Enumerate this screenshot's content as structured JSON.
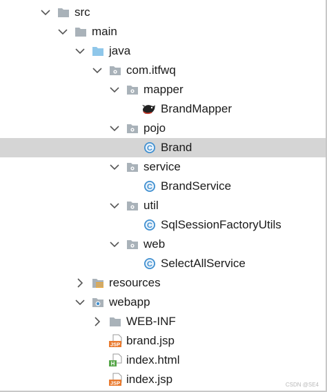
{
  "tree": {
    "items": [
      {
        "label": "src",
        "depth": 0,
        "expanded": true,
        "icon": "folder-gray-icon"
      },
      {
        "label": "main",
        "depth": 1,
        "expanded": true,
        "icon": "folder-gray-icon"
      },
      {
        "label": "java",
        "depth": 2,
        "expanded": true,
        "icon": "folder-source-blue-icon"
      },
      {
        "label": "com.itfwq",
        "depth": 3,
        "expanded": true,
        "icon": "package-icon"
      },
      {
        "label": "mapper",
        "depth": 4,
        "expanded": true,
        "icon": "package-icon"
      },
      {
        "label": "BrandMapper",
        "depth": 5,
        "icon": "mybatis-mapper-icon"
      },
      {
        "label": "pojo",
        "depth": 4,
        "expanded": true,
        "icon": "package-icon"
      },
      {
        "label": "Brand",
        "depth": 5,
        "icon": "java-class-icon",
        "selected": true
      },
      {
        "label": "service",
        "depth": 4,
        "expanded": true,
        "icon": "package-icon"
      },
      {
        "label": "BrandService",
        "depth": 5,
        "icon": "java-class-icon"
      },
      {
        "label": "util",
        "depth": 4,
        "expanded": true,
        "icon": "package-icon"
      },
      {
        "label": "SqlSessionFactoryUtils",
        "depth": 5,
        "icon": "java-class-icon"
      },
      {
        "label": "web",
        "depth": 4,
        "expanded": true,
        "icon": "package-icon"
      },
      {
        "label": "SelectAllService",
        "depth": 5,
        "icon": "java-class-icon"
      },
      {
        "label": "resources",
        "depth": 2,
        "expanded": false,
        "icon": "resources-folder-icon"
      },
      {
        "label": "webapp",
        "depth": 2,
        "expanded": true,
        "icon": "web-folder-icon"
      },
      {
        "label": "WEB-INF",
        "depth": 3,
        "expanded": false,
        "icon": "folder-gray-icon"
      },
      {
        "label": "brand.jsp",
        "depth": 3,
        "icon": "jsp-file-icon"
      },
      {
        "label": "index.html",
        "depth": 3,
        "icon": "html-file-icon"
      },
      {
        "label": "index.jsp",
        "depth": 3,
        "icon": "jsp-file-icon"
      }
    ]
  },
  "icon_text": {
    "jsp": "JSP",
    "html": "H",
    "class": "C"
  },
  "colors": {
    "folder": "#a9b2b9",
    "source_folder": "#8fc7ea",
    "selection": "#d5d5d5",
    "class_icon": "#3f8fd0",
    "jsp_icon": "#e97b30",
    "html_icon": "#57a64a"
  },
  "watermark": "CSDN @SE4"
}
